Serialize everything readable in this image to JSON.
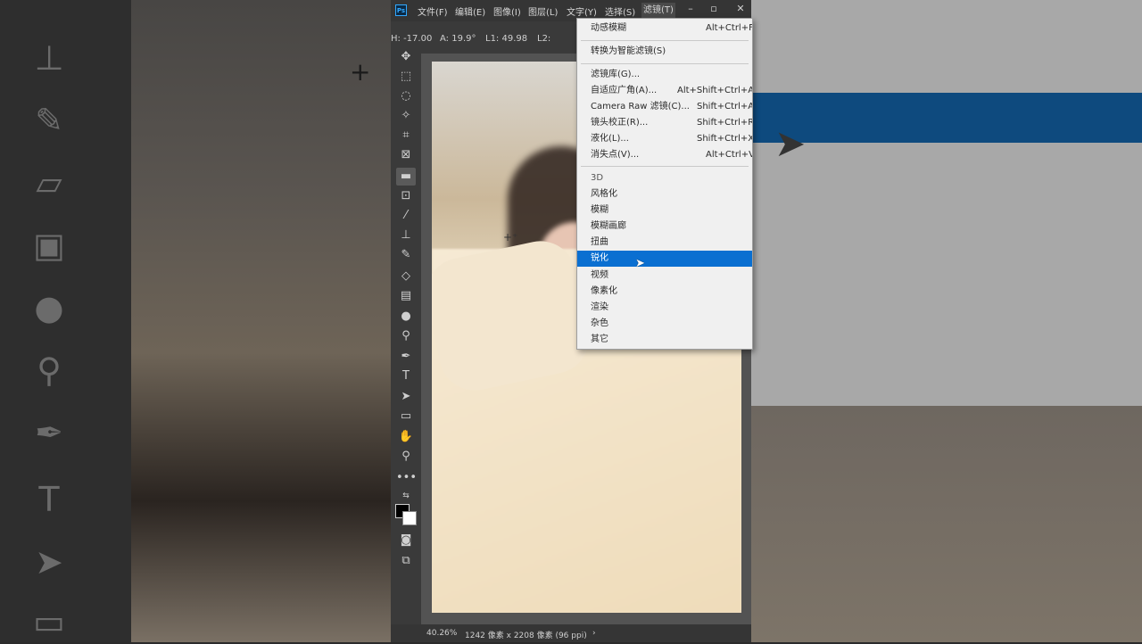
{
  "menubar": {
    "logo": "Ps",
    "items": [
      "文件(F)",
      "编辑(E)",
      "图像(I)",
      "图层(L)",
      "文字(Y)",
      "选择(S)",
      "滤镜(T)"
    ]
  },
  "options": {
    "h": "H: -17.00",
    "a": "A: 19.9°",
    "l1": "L1: 49.98",
    "l2": "L2:"
  },
  "filter_menu": {
    "top": [
      {
        "label": "动感模糊",
        "shortcut": "Alt+Ctrl+F"
      }
    ],
    "smart": [
      {
        "label": "转换为智能滤镜(S)",
        "shortcut": ""
      }
    ],
    "library": [
      {
        "label": "滤镜库(G)...",
        "shortcut": ""
      },
      {
        "label": "自适应广角(A)...",
        "shortcut": "Alt+Shift+Ctrl+A"
      },
      {
        "label": "Camera Raw 滤镜(C)...",
        "shortcut": "Shift+Ctrl+A"
      },
      {
        "label": "镜头校正(R)...",
        "shortcut": "Shift+Ctrl+R"
      },
      {
        "label": "液化(L)...",
        "shortcut": "Shift+Ctrl+X"
      },
      {
        "label": "消失点(V)...",
        "shortcut": "Alt+Ctrl+V"
      }
    ],
    "groups": [
      "3D",
      "风格化",
      "模糊",
      "模糊画廊",
      "扭曲",
      "锐化",
      "视频",
      "像素化",
      "渲染",
      "杂色",
      "其它"
    ],
    "highlighted": "锐化"
  },
  "status": {
    "zoom": "40.26%",
    "doc_size": "1242 像素 x 2208 像素 (96 ppi)",
    "arrow": "›"
  },
  "colors": {
    "highlight": "#0a6fd1",
    "ui_dark": "#353535",
    "panel": "#3a3a3a"
  }
}
